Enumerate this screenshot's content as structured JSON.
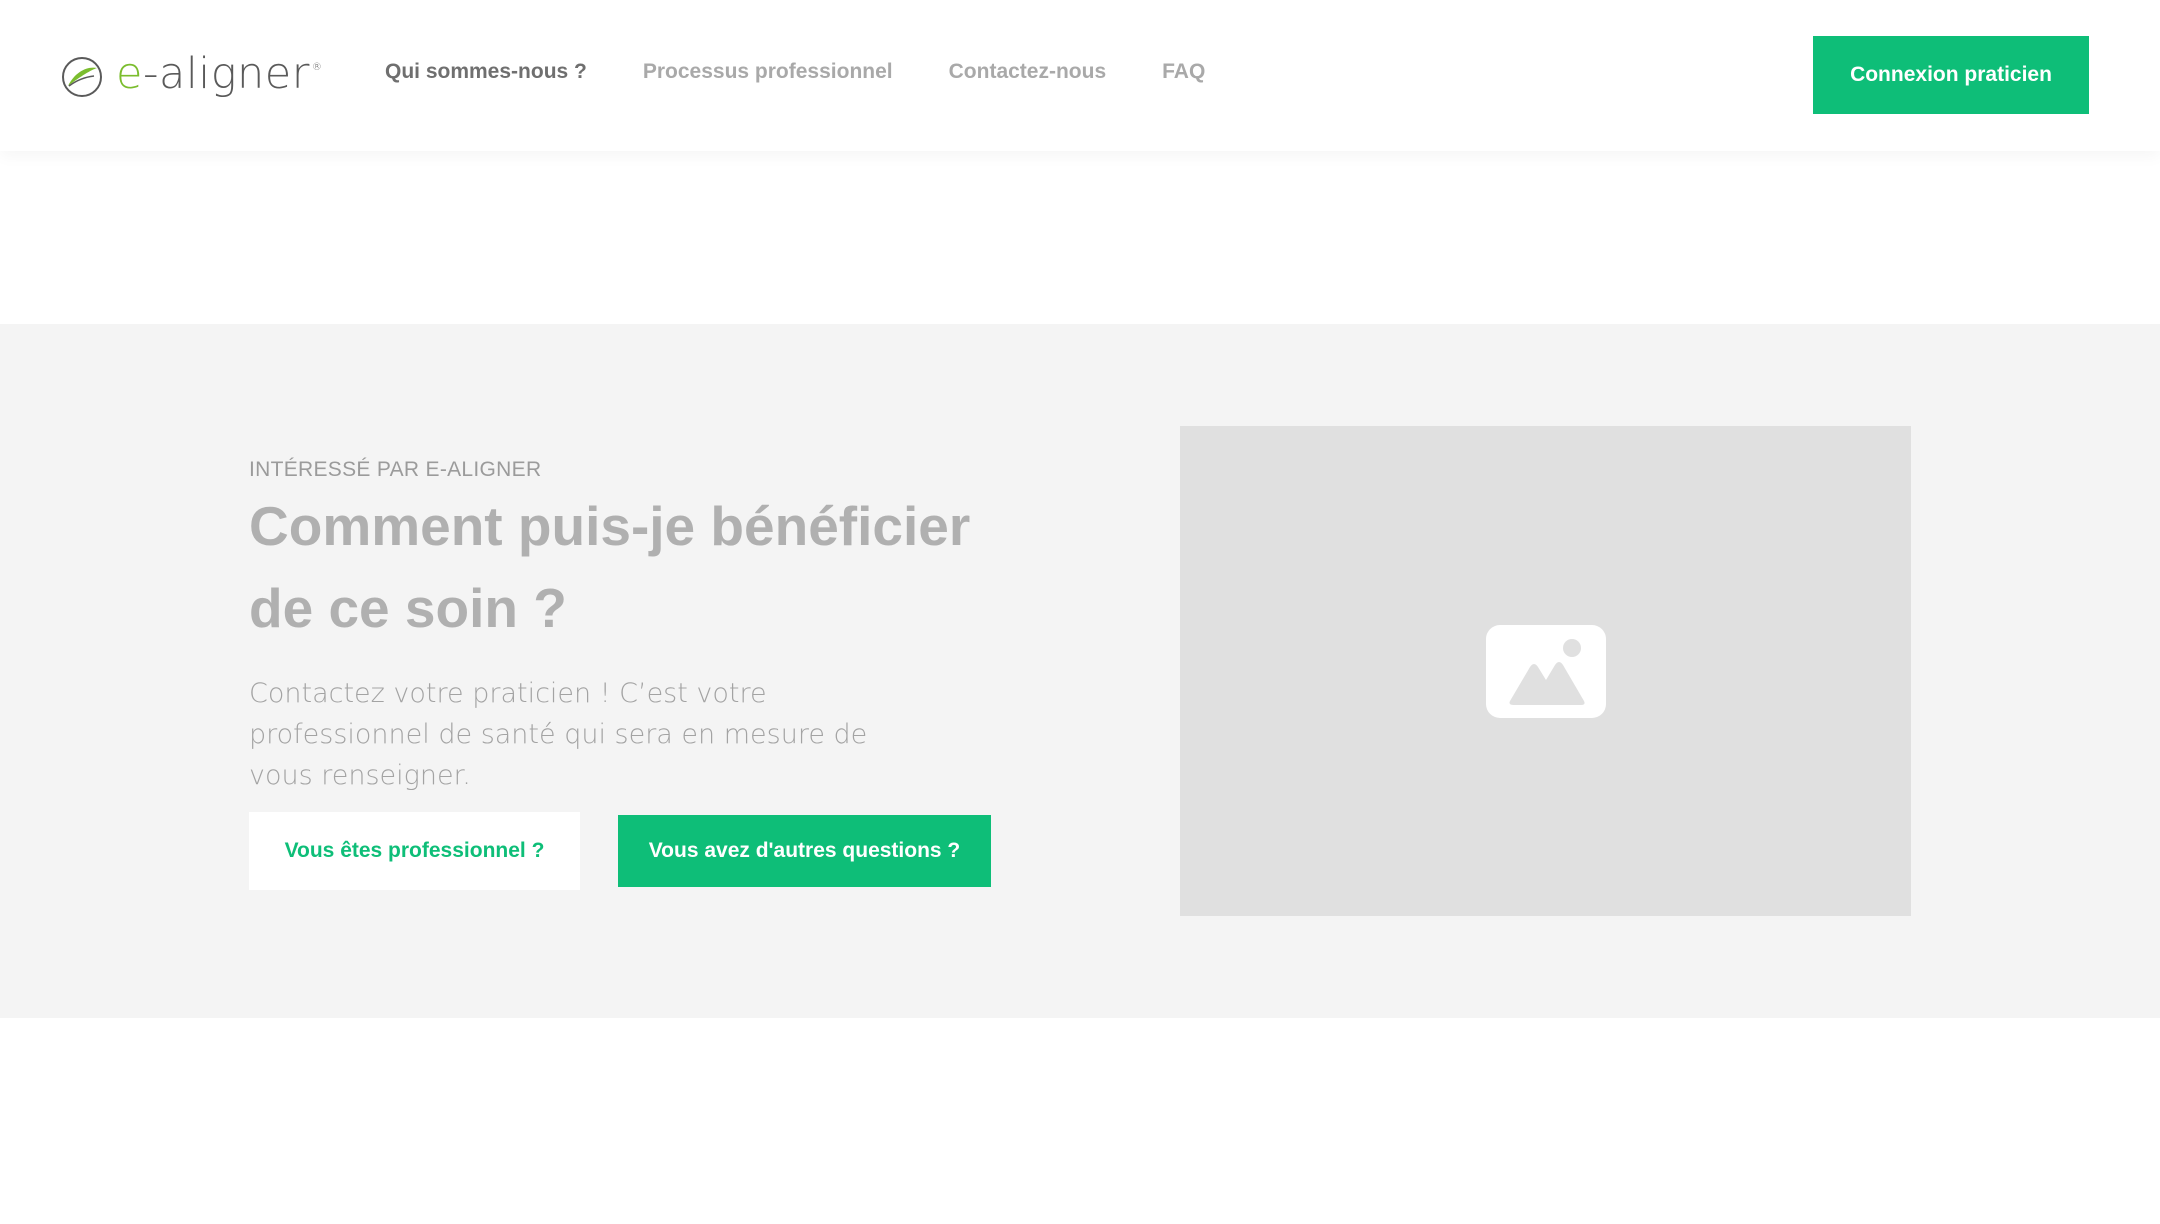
{
  "header": {
    "logo": {
      "text_prefix": "e",
      "text_rest": "-aligner",
      "registered": "®",
      "icon": "leaf-circle-logo-icon"
    },
    "nav": [
      {
        "label": "Qui sommes-nous ?",
        "active": true
      },
      {
        "label": "Processus professionnel",
        "active": false
      },
      {
        "label": "Contactez-nous",
        "active": false
      },
      {
        "label": "FAQ",
        "active": false
      }
    ],
    "login_button": "Connexion praticien"
  },
  "hero": {
    "eyebrow": "INTÉRESSÉ PAR E-ALIGNER",
    "heading": "Comment puis-je bénéficier de ce soin ?",
    "lead": "Contactez votre praticien ! C’est votre professionnel de santé qui sera en mesure de vous renseigner.",
    "button_professional": "Vous êtes professionnel ?",
    "button_questions": "Vous avez d'autres questions ?",
    "image_icon": "image-placeholder-icon"
  },
  "colors": {
    "accent": "#0ebe78",
    "logo_green": "#7bbd2e",
    "section_bg": "#f4f4f4",
    "placeholder_bg": "#e0e0e0"
  }
}
